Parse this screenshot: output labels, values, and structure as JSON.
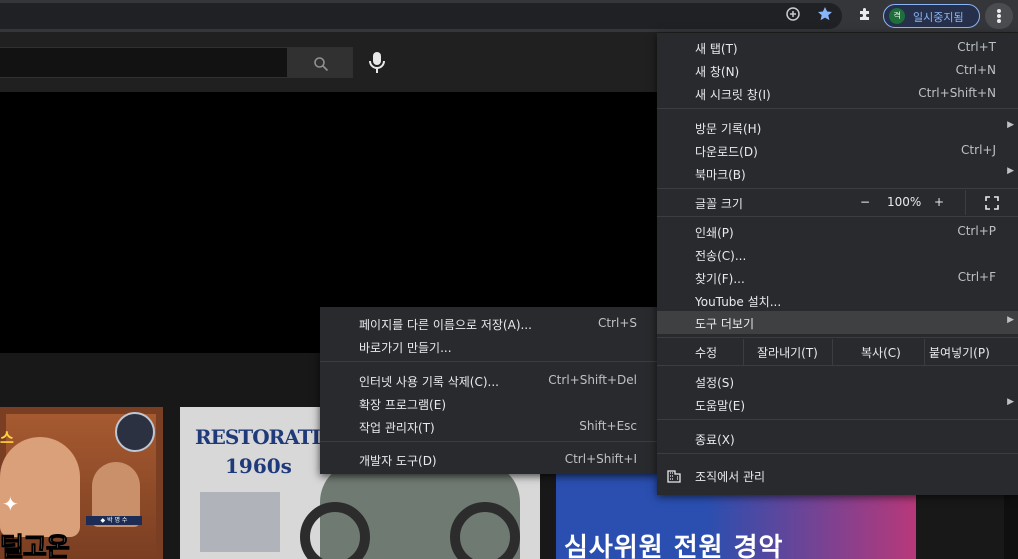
{
  "browser": {
    "profile_label": "일시중지됨",
    "profile_avatar_letter": "격",
    "accent_color": "#8ab4f8"
  },
  "thumbnails": [
    {
      "caption": "털고온",
      "caption_top": "스",
      "nametag": "◆ 박 명 수"
    },
    {
      "title_line1": "RESTORATION",
      "title_line2": "1960s"
    },
    {
      "caption": "심사위원 전원 경악"
    }
  ],
  "menu": {
    "new_tab": {
      "label": "새 탭(T)",
      "shortcut": "Ctrl+T"
    },
    "new_window": {
      "label": "새 창(N)",
      "shortcut": "Ctrl+N"
    },
    "incognito": {
      "label": "새 시크릿 창(I)",
      "shortcut": "Ctrl+Shift+N"
    },
    "history": {
      "label": "방문 기록(H)"
    },
    "downloads": {
      "label": "다운로드(D)",
      "shortcut": "Ctrl+J"
    },
    "bookmarks": {
      "label": "북마크(B)"
    },
    "zoom": {
      "label": "글꼴 크기",
      "minus": "−",
      "value": "100%",
      "plus": "+"
    },
    "print": {
      "label": "인쇄(P)",
      "shortcut": "Ctrl+P"
    },
    "cast": {
      "label": "전송(C)..."
    },
    "find": {
      "label": "찾기(F)...",
      "shortcut": "Ctrl+F"
    },
    "install": {
      "label": "YouTube 설치..."
    },
    "more_tools": {
      "label": "도구 더보기"
    },
    "edit": {
      "label": "수정",
      "cut": "잘라내기(T)",
      "copy": "복사(C)",
      "paste": "붙여넣기(P)"
    },
    "settings": {
      "label": "설정(S)"
    },
    "help": {
      "label": "도움말(E)"
    },
    "exit": {
      "label": "종료(X)"
    },
    "managed": {
      "label": "조직에서 관리"
    }
  },
  "submenu": {
    "save_page": {
      "label": "페이지를 다른 이름으로 저장(A)...",
      "shortcut": "Ctrl+S"
    },
    "create_shortcut": {
      "label": "바로가기 만들기..."
    },
    "clear_data": {
      "label": "인터넷 사용 기록 삭제(C)...",
      "shortcut": "Ctrl+Shift+Del"
    },
    "extensions": {
      "label": "확장 프로그램(E)"
    },
    "task_manager": {
      "label": "작업 관리자(T)",
      "shortcut": "Shift+Esc"
    },
    "dev_tools": {
      "label": "개발자 도구(D)",
      "shortcut": "Ctrl+Shift+I"
    }
  }
}
